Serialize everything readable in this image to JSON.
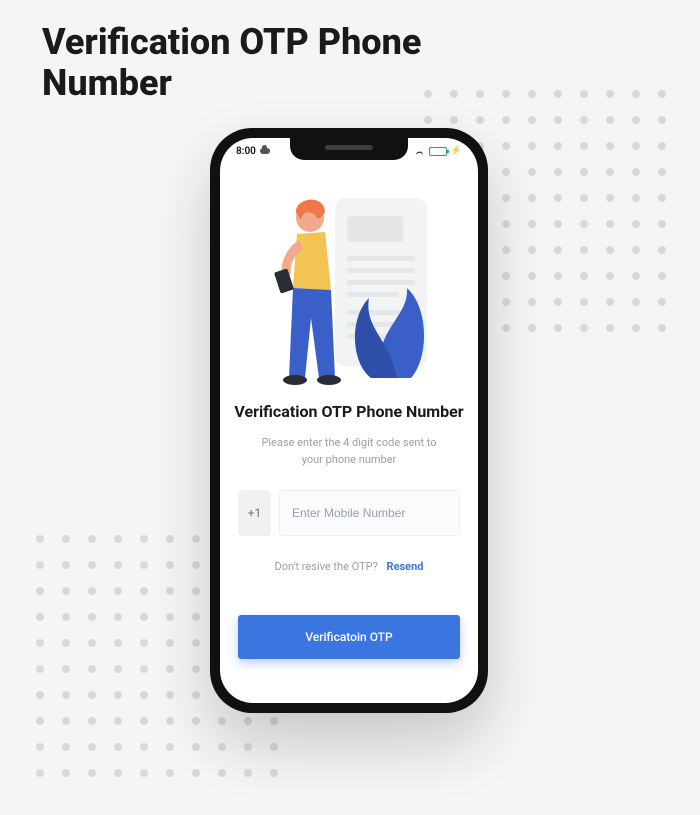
{
  "page": {
    "title": "Verification OTP Phone Number"
  },
  "statusbar": {
    "time": "8:00"
  },
  "screen": {
    "title": "Verification OTP Phone Number",
    "subtitle": "Please enter the 4 digit code sent to your phone number",
    "country_code": "+1",
    "phone_placeholder": "Enter Mobile Number",
    "resend_prompt": "Don't resive the OTP?",
    "resend_action": "Resend",
    "verify_button": "Verificatoin OTP"
  }
}
